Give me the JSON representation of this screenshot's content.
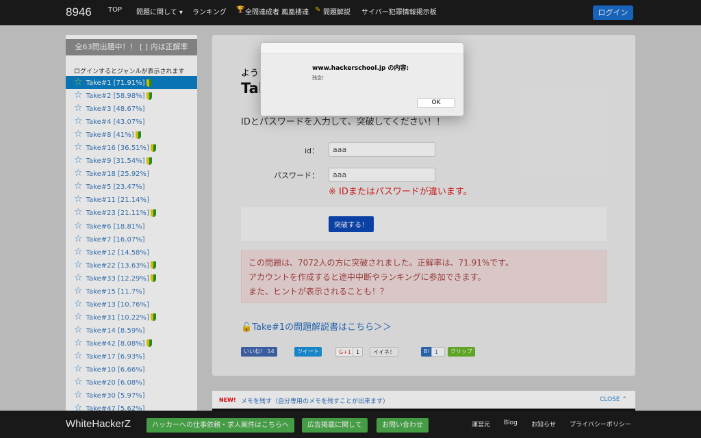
{
  "header": {
    "brand": "8946",
    "nav": [
      "TOP",
      "問題に関して ▾",
      "ランキング",
      "全問達成者 鳳凰楼達",
      "問題解説",
      "サイバー犯罪情報掲示板"
    ],
    "login": "ログイン"
  },
  "sidebar": {
    "heading": "全63問出題中！！ [ ] 内は正解率",
    "note": "ログインするとジャンルが表示されます",
    "items": [
      {
        "label": "Take#1 [71.91%]",
        "badge": true
      },
      {
        "label": "Take#2 [58.98%]",
        "badge": true
      },
      {
        "label": "Take#3 [48.67%]",
        "badge": false
      },
      {
        "label": "Take#4 [43.07%]",
        "badge": false
      },
      {
        "label": "Take#8 [41%]",
        "badge": true
      },
      {
        "label": "Take#16 [36.51%]",
        "badge": true
      },
      {
        "label": "Take#9 [31.54%]",
        "badge": true
      },
      {
        "label": "Take#18 [25.92%]",
        "badge": false
      },
      {
        "label": "Take#5 [23.47%]",
        "badge": false
      },
      {
        "label": "Take#11 [21.14%]",
        "badge": false
      },
      {
        "label": "Take#23 [21.11%]",
        "badge": true
      },
      {
        "label": "Take#6 [18.81%]",
        "badge": false
      },
      {
        "label": "Take#7 [16.07%]",
        "badge": false
      },
      {
        "label": "Take#12 [14.58%]",
        "badge": false
      },
      {
        "label": "Take#22 [13.63%]",
        "badge": true
      },
      {
        "label": "Take#33 [12.29%]",
        "badge": true
      },
      {
        "label": "Take#15 [11.7%]",
        "badge": false
      },
      {
        "label": "Take#13 [10.76%]",
        "badge": false
      },
      {
        "label": "Take#31 [10.22%]",
        "badge": true
      },
      {
        "label": "Take#14 [8.59%]",
        "badge": false
      },
      {
        "label": "Take#42 [8.08%]",
        "badge": true
      },
      {
        "label": "Take#17 [6.93%]",
        "badge": false
      },
      {
        "label": "Take#10 [6.66%]",
        "badge": false
      },
      {
        "label": "Take#20 [6.08%]",
        "badge": false
      },
      {
        "label": "Take#30 [5.97%]",
        "badge": false
      },
      {
        "label": "Take#47 [5.62%]",
        "badge": false
      }
    ]
  },
  "main": {
    "greet": "よう",
    "title": "Tak",
    "instruction": "IDとパスワードを入力して、突破してください！！",
    "id_label": "id：",
    "id_value": "aaa",
    "pw_label": "パスワード：",
    "pw_value": "aaa",
    "error": "※ IDまたはパスワードが違います。",
    "submit": "突破する！",
    "alert": [
      "この問題は、7072人の方に突破されました。正解率は、71.91%です。",
      "アカウントを作成すると途中中断やランキングに参加できます。",
      "また、ヒントが表示されることも！？"
    ],
    "guide": "Take#1の問題解説書はこちら＞＞",
    "social": {
      "like": "いいね！ 14",
      "tweet": "ツイート",
      "gplus": "G+1",
      "gplus_count": "1",
      "iine": "イイネ！",
      "hatena": "B!",
      "hatena_count": "1",
      "clip": "クリップ"
    }
  },
  "memo": {
    "new": "NEW!",
    "text": "メモを残す（自分専用のメモを残すことが出来ます）",
    "close": "CLOSE ⌃"
  },
  "footer": {
    "brand": "WhiteHackerZ",
    "buttons": [
      "ハッカーへの仕事依頼・求人案件はこちらへ",
      "広告掲載に関して",
      "お問い合わせ"
    ],
    "links": [
      "運営元",
      "Blog",
      "お知らせ",
      "プライバシーポリシー"
    ]
  },
  "dialog": {
    "title": "www.hackerschool.jp の内容:",
    "message": "残念！",
    "ok": "OK"
  }
}
